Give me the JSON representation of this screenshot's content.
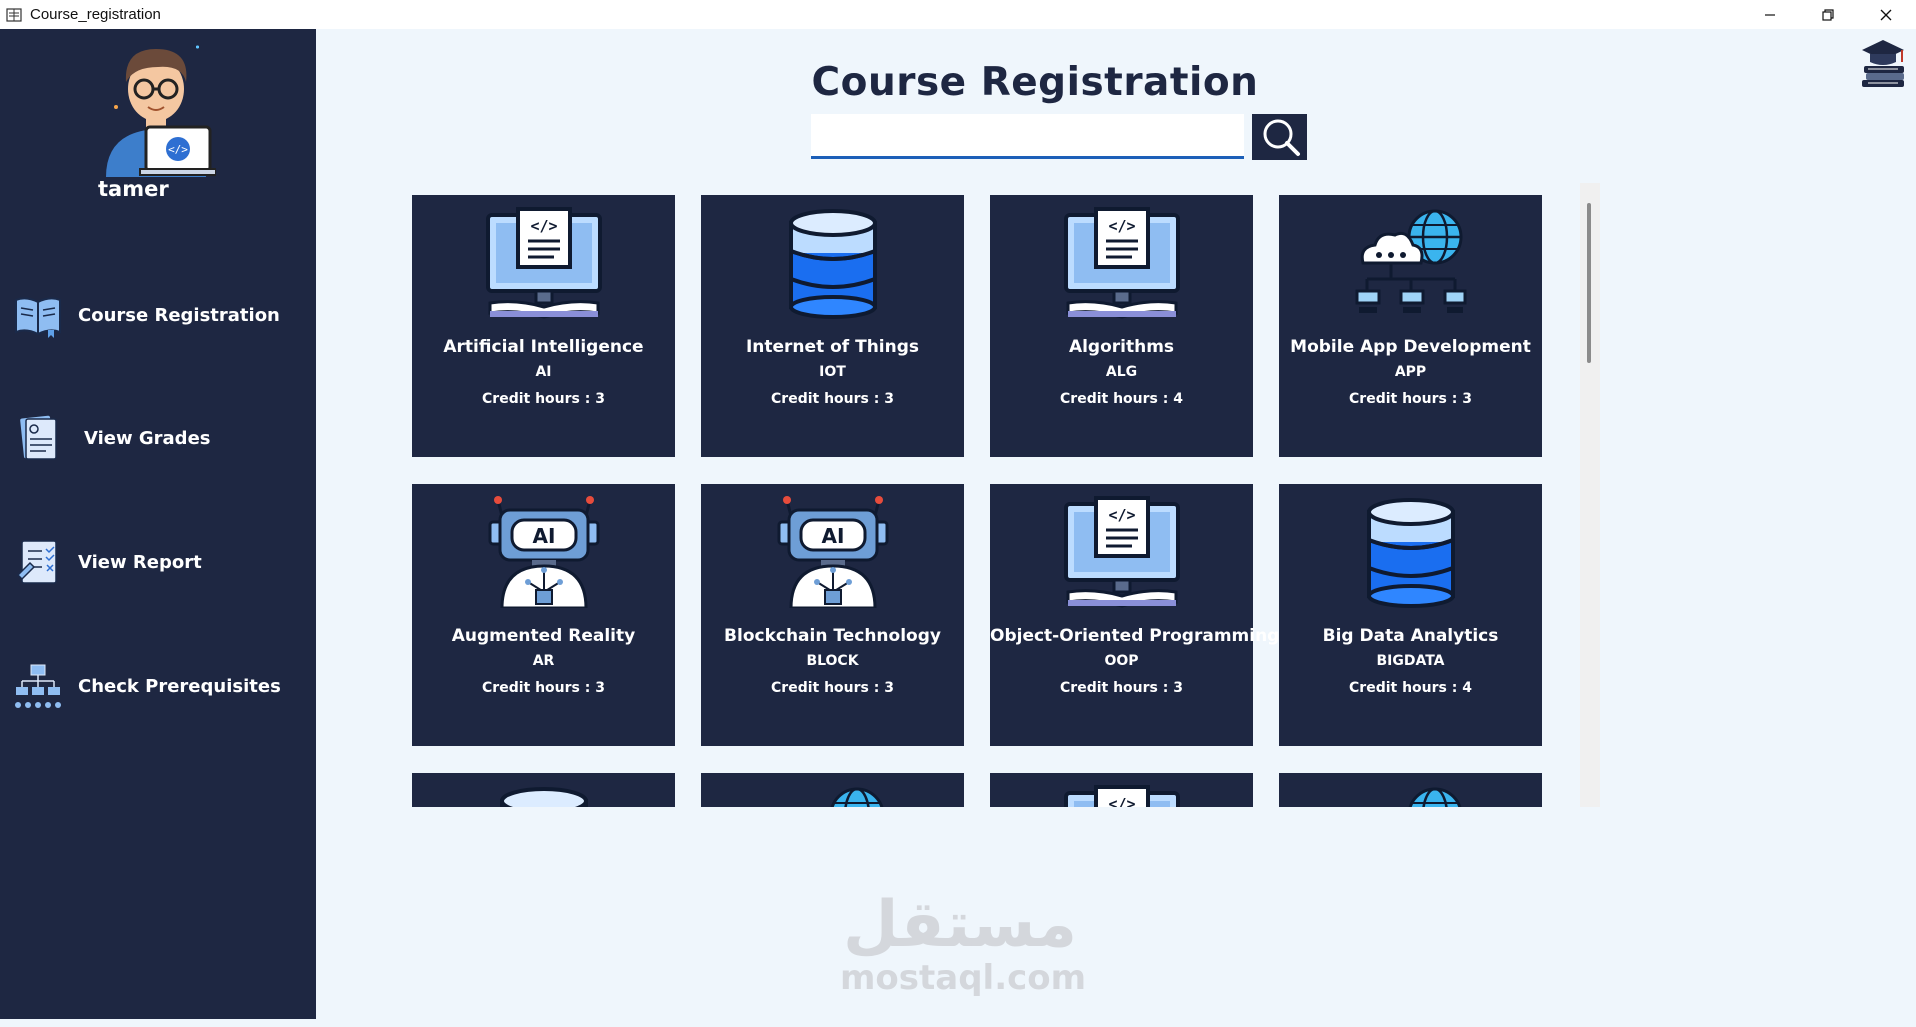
{
  "window": {
    "title": "Course_registration"
  },
  "user": {
    "name": "tamer"
  },
  "sidebar": {
    "items": [
      {
        "label": "Course Registration",
        "icon": "book-icon"
      },
      {
        "label": "View Grades",
        "icon": "grades-document-icon"
      },
      {
        "label": "View Report",
        "icon": "report-icon"
      },
      {
        "label": "Check Prerequisites",
        "icon": "hierarchy-icon"
      }
    ]
  },
  "header": {
    "title": "Course Registration"
  },
  "search": {
    "value": "",
    "placeholder": ""
  },
  "courses": [
    {
      "name": "Artificial Intelligence",
      "code": "AI",
      "hours_text": "Credit hours :  3",
      "icon": "monitor-code-icon"
    },
    {
      "name": "Internet of Things",
      "code": "IOT",
      "hours_text": "Credit hours :  3",
      "icon": "database-icon"
    },
    {
      "name": "Algorithms",
      "code": "ALG",
      "hours_text": "Credit hours :  4",
      "icon": "monitor-code-icon"
    },
    {
      "name": "Mobile App Development",
      "code": "APP",
      "hours_text": "Credit hours :  3",
      "icon": "cloud-network-icon"
    },
    {
      "name": "Augmented Reality",
      "code": "AR",
      "hours_text": "Credit hours :  3",
      "icon": "ai-robot-icon"
    },
    {
      "name": "Blockchain Technology",
      "code": "BLOCK",
      "hours_text": "Credit hours :  3",
      "icon": "ai-robot-icon"
    },
    {
      "name": "Object-Oriented Programming",
      "code": "OOP",
      "hours_text": "Credit hours :  3",
      "icon": "monitor-code-icon"
    },
    {
      "name": "Big Data Analytics",
      "code": "BIGDATA",
      "hours_text": "Credit hours :  4",
      "icon": "database-icon"
    },
    {
      "name": "",
      "code": "",
      "hours_text": "",
      "icon": "database-icon"
    },
    {
      "name": "",
      "code": "",
      "hours_text": "",
      "icon": "cloud-network-icon"
    },
    {
      "name": "",
      "code": "",
      "hours_text": "",
      "icon": "monitor-code-icon"
    },
    {
      "name": "",
      "code": "",
      "hours_text": "",
      "icon": "cloud-network-icon"
    }
  ],
  "watermark": {
    "arabic": "مستقل",
    "latin": "mostaql.com"
  },
  "colors": {
    "sidebar": "#1e2742",
    "card": "#1e2742",
    "background": "#eff6fc",
    "accent": "#1c5fb8"
  }
}
